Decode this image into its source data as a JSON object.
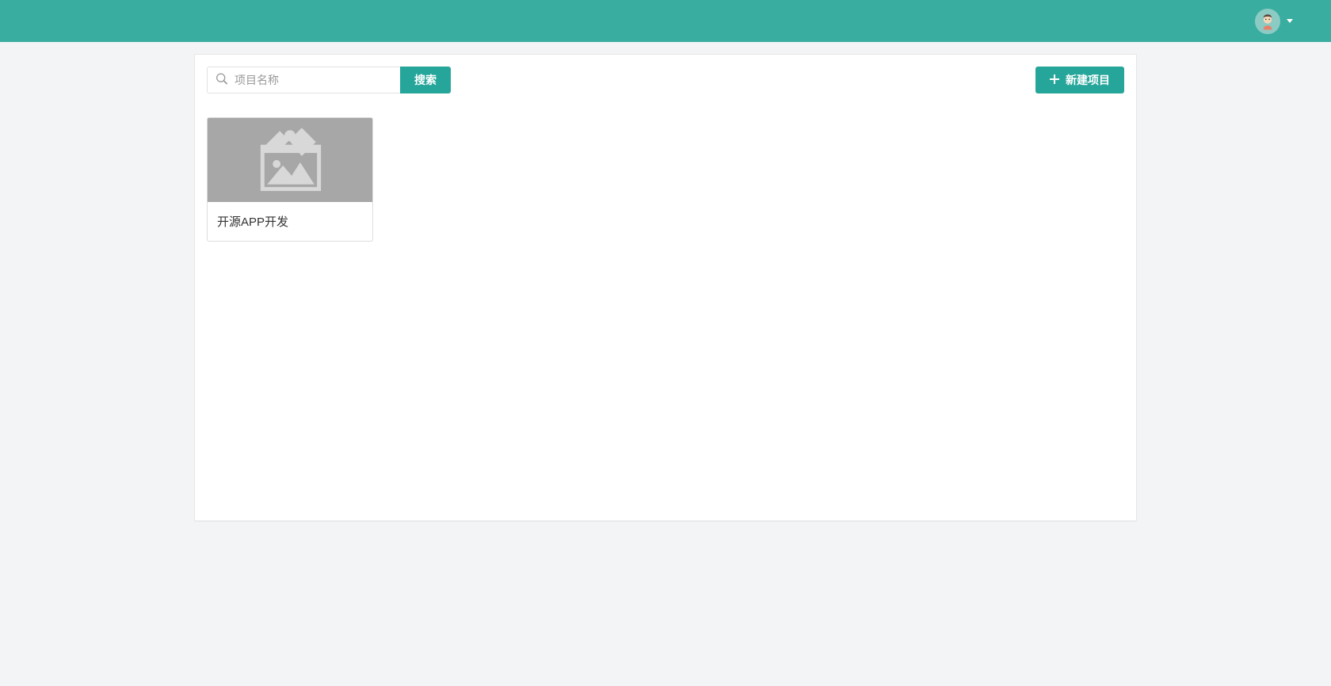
{
  "header": {
    "user_menu": {
      "avatar_label": "user-avatar"
    }
  },
  "toolbar": {
    "search": {
      "placeholder": "项目名称",
      "value": ""
    },
    "search_button_label": "搜索",
    "new_button_label": "新建项目"
  },
  "projects": [
    {
      "title": "开源APP开发"
    }
  ],
  "colors": {
    "brand": "#3aada1",
    "accent": "#26a69a",
    "page_bg": "#f2f4f5"
  }
}
